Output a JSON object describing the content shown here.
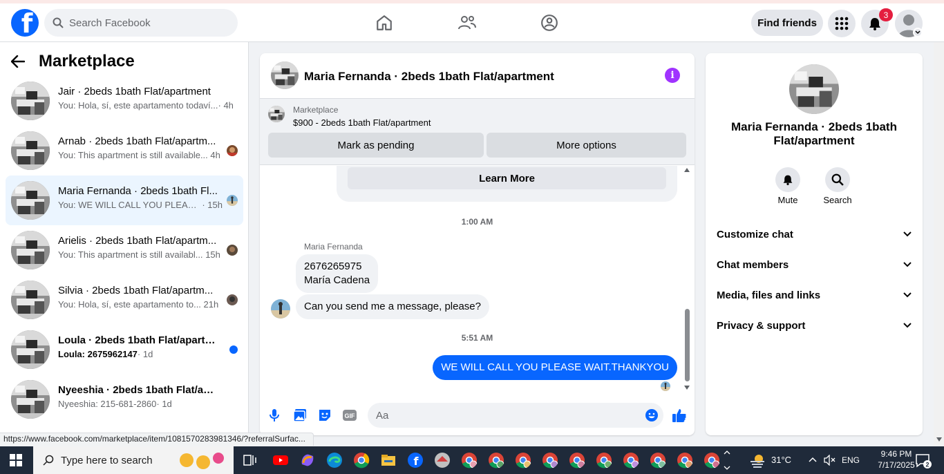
{
  "topbar": {
    "logo_letter": "f",
    "search_placeholder": "Search Facebook",
    "find_friends_label": "Find friends",
    "notification_count": "3"
  },
  "sidebar": {
    "title": "Marketplace",
    "conversations": [
      {
        "title": "Jair · 2beds 1bath Flat/apartment",
        "preview": "You: Hola, sí, este apartamento todaví...",
        "time": "· 4h"
      },
      {
        "title": "Arnab · 2beds 1bath Flat/apartm...",
        "preview": "You: This apartment is still available...",
        "time": "4h"
      },
      {
        "title": "Maria Fernanda · 2beds 1bath Fl...",
        "preview": "You: WE WILL CALL YOU PLEASE ...",
        "time": "· 15h"
      },
      {
        "title": "Arielis · 2beds 1bath Flat/apartm...",
        "preview": "You: This apartment is still availabl...",
        "time": "15h"
      },
      {
        "title": "Silvia · 2beds 1bath Flat/apartm...",
        "preview": "You: Hola, sí, este apartamento to...",
        "time": "21h"
      },
      {
        "title": "Loula · 2beds 1bath Flat/apartme...",
        "preview": "Loula: 2675962147",
        "time": " · 1d"
      },
      {
        "title": "Nyeeshia · 2beds 1bath Flat/apart...",
        "preview": "Nyeeshia: 215-681-2860",
        "time": " · 1d"
      }
    ]
  },
  "chat": {
    "title": "Maria Fernanda · 2beds 1bath Flat/apartment",
    "info_glyph": "i",
    "marketplace_label": "Marketplace",
    "listing": "$900 - 2beds 1bath Flat/apartment",
    "mark_pending_label": "Mark as pending",
    "more_options_label": "More options",
    "learn_more_label": "Learn More",
    "time_1": "1:00 AM",
    "sender": "Maria Fernanda",
    "msg_1_line1": "2676265975",
    "msg_1_line2": "María Cadena",
    "msg_2": "Can you send me a message, please?",
    "time_2": "5:51 AM",
    "msg_out": "WE WILL CALL YOU PLEASE WAIT.THANKYOU",
    "composer_placeholder": "Aa",
    "gif_label": "GIF"
  },
  "details": {
    "name": "Maria Fernanda · 2beds 1bath Flat/apartment",
    "mute_label": "Mute",
    "search_label": "Search",
    "rows": [
      "Customize chat",
      "Chat members",
      "Media, files and links",
      "Privacy & support"
    ]
  },
  "status_url": "https://www.facebook.com/marketplace/item/1081570283981346/?referralSurfac...",
  "taskbar": {
    "search_placeholder": "Type here to search",
    "weather": "31°C",
    "lang": "ENG",
    "time": "9:46 PM",
    "date": "7/17/2025",
    "notifications": "2"
  },
  "colors": {
    "brand": "#0866ff",
    "badge": "#e41e3f",
    "info": "#a033ff",
    "active_row": "#ebf5ff"
  }
}
